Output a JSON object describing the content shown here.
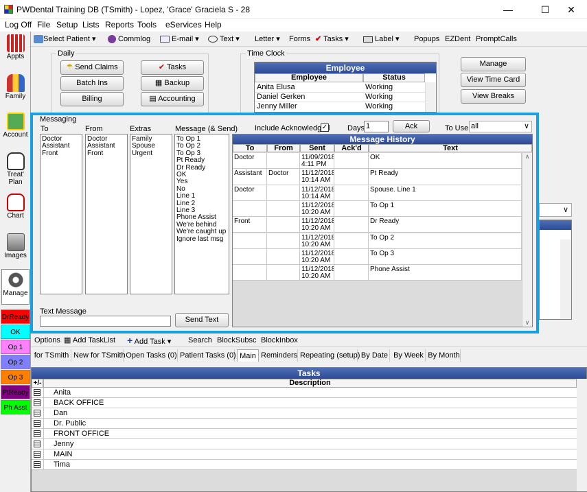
{
  "title": "PWDental Training DB (TSmith) - Lopez, 'Grace' Graciela S - 28",
  "menu": [
    "Log Off",
    "File",
    "Setup",
    "Lists",
    "Reports",
    "Tools",
    "eServices",
    "Help"
  ],
  "toolbar": {
    "select_patient": "Select Patient",
    "commlog": "Commlog",
    "email": "E-mail",
    "text": "Text",
    "letter": "Letter",
    "forms": "Forms",
    "tasks": "Tasks",
    "label": "Label",
    "popups": "Popups",
    "ezdent": "EZDent",
    "promptcalls": "PromptCalls"
  },
  "sidebar": {
    "appts": "Appts",
    "family": "Family",
    "account": "Account",
    "treat": "Treat' Plan",
    "chart": "Chart",
    "images": "Images",
    "manage": "Manage"
  },
  "signals": [
    {
      "label": "DrReady",
      "color": "#ff0000"
    },
    {
      "label": "OK",
      "color": "#00ffff"
    },
    {
      "label": "Op 1",
      "color": "#ff80ff"
    },
    {
      "label": "Op 2",
      "color": "#8080ff"
    },
    {
      "label": "Op 3",
      "color": "#ff8000"
    },
    {
      "label": "PtReady",
      "color": "#800080"
    },
    {
      "label": "Ph Asst",
      "color": "#00ff00"
    }
  ],
  "daily": {
    "label": "Daily",
    "send_claims": "Send Claims",
    "batch_ins": "Batch Ins",
    "billing": "Billing",
    "tasks": "Tasks",
    "backup": "Backup",
    "accounting": "Accounting"
  },
  "timeclock": {
    "label": "Time Clock",
    "header": "Employee",
    "col_employee": "Employee",
    "col_status": "Status",
    "rows": [
      {
        "employee": "Anita  Elusa",
        "status": "Working"
      },
      {
        "employee": "Daniel  Gerken",
        "status": "Working"
      },
      {
        "employee": "Jenny  Miller",
        "status": "Working"
      }
    ],
    "manage": "Manage",
    "view_time_card": "View Time Card",
    "view_breaks": "View Breaks"
  },
  "messaging": {
    "label": "Messaging",
    "to_label": "To",
    "from_label": "From",
    "extras_label": "Extras",
    "message_label": "Message (& Send)",
    "to": [
      "Doctor",
      "Assistant",
      "Front"
    ],
    "from": [
      "Doctor",
      "Assistant",
      "Front"
    ],
    "extras": [
      "Family",
      "Spouse",
      "Urgent"
    ],
    "messages": [
      "To Op 1",
      "To Op 2",
      "To Op 3",
      "Pt Ready",
      "Dr Ready",
      "OK",
      "Yes",
      "No",
      "Line 1",
      "Line 2",
      "Line 3",
      "Phone Assist",
      "We're behind",
      "We're caught up",
      "Ignore last msg"
    ],
    "include_ack": "Include Acknowledged",
    "days_label": "Days",
    "days_value": "1",
    "ack": "Ack",
    "to_user_label": "To User",
    "to_user_value": "all",
    "text_message_label": "Text Message",
    "send_text": "Send Text"
  },
  "history": {
    "header": "Message History",
    "cols": [
      "To",
      "From",
      "Sent",
      "Ack'd",
      "Text"
    ],
    "rows": [
      {
        "to": "Doctor",
        "from": "",
        "sent": "11/09/2018 4:11 PM",
        "ack": "",
        "text": "OK"
      },
      {
        "to": "Assistant",
        "from": "Doctor",
        "sent": "11/12/2018 10:14 AM",
        "ack": "",
        "text": "Pt Ready"
      },
      {
        "to": "Doctor",
        "from": "",
        "sent": "11/12/2018 10:14 AM",
        "ack": "",
        "text": "Spouse.  Line 1"
      },
      {
        "to": "",
        "from": "",
        "sent": "11/12/2018 10:20 AM",
        "ack": "",
        "text": "To Op 1"
      },
      {
        "to": "Front",
        "from": "",
        "sent": "11/12/2018 10:20 AM",
        "ack": "",
        "text": "Dr Ready"
      },
      {
        "to": "",
        "from": "",
        "sent": "11/12/2018 10:20 AM",
        "ack": "",
        "text": "To Op 2"
      },
      {
        "to": "",
        "from": "",
        "sent": "11/12/2018 10:20 AM",
        "ack": "",
        "text": "To Op 3"
      },
      {
        "to": "",
        "from": "",
        "sent": "11/12/2018 10:20 AM",
        "ack": "",
        "text": "Phone Assist"
      }
    ]
  },
  "tasktoolbar": {
    "options": "Options",
    "add_tasklist": "Add TaskList",
    "add_task": "Add Task",
    "search": "Search",
    "blocksubsc": "BlockSubsc",
    "blockinbox": "BlockInbox"
  },
  "tasktabs": [
    "for TSmith",
    "New for TSmith",
    "Open Tasks (0)",
    "Patient Tasks (0)",
    "Main",
    "Reminders",
    "Repeating (setup)",
    "By Date",
    "By Week",
    "By Month"
  ],
  "tasks": {
    "header": "Tasks",
    "col_pm": "+/-",
    "col_desc": "Description",
    "rows": [
      "Anita",
      "BACK OFFICE",
      "Dan",
      "Dr. Public",
      "FRONT OFFICE",
      "Jenny",
      "MAIN",
      "Tima"
    ]
  }
}
